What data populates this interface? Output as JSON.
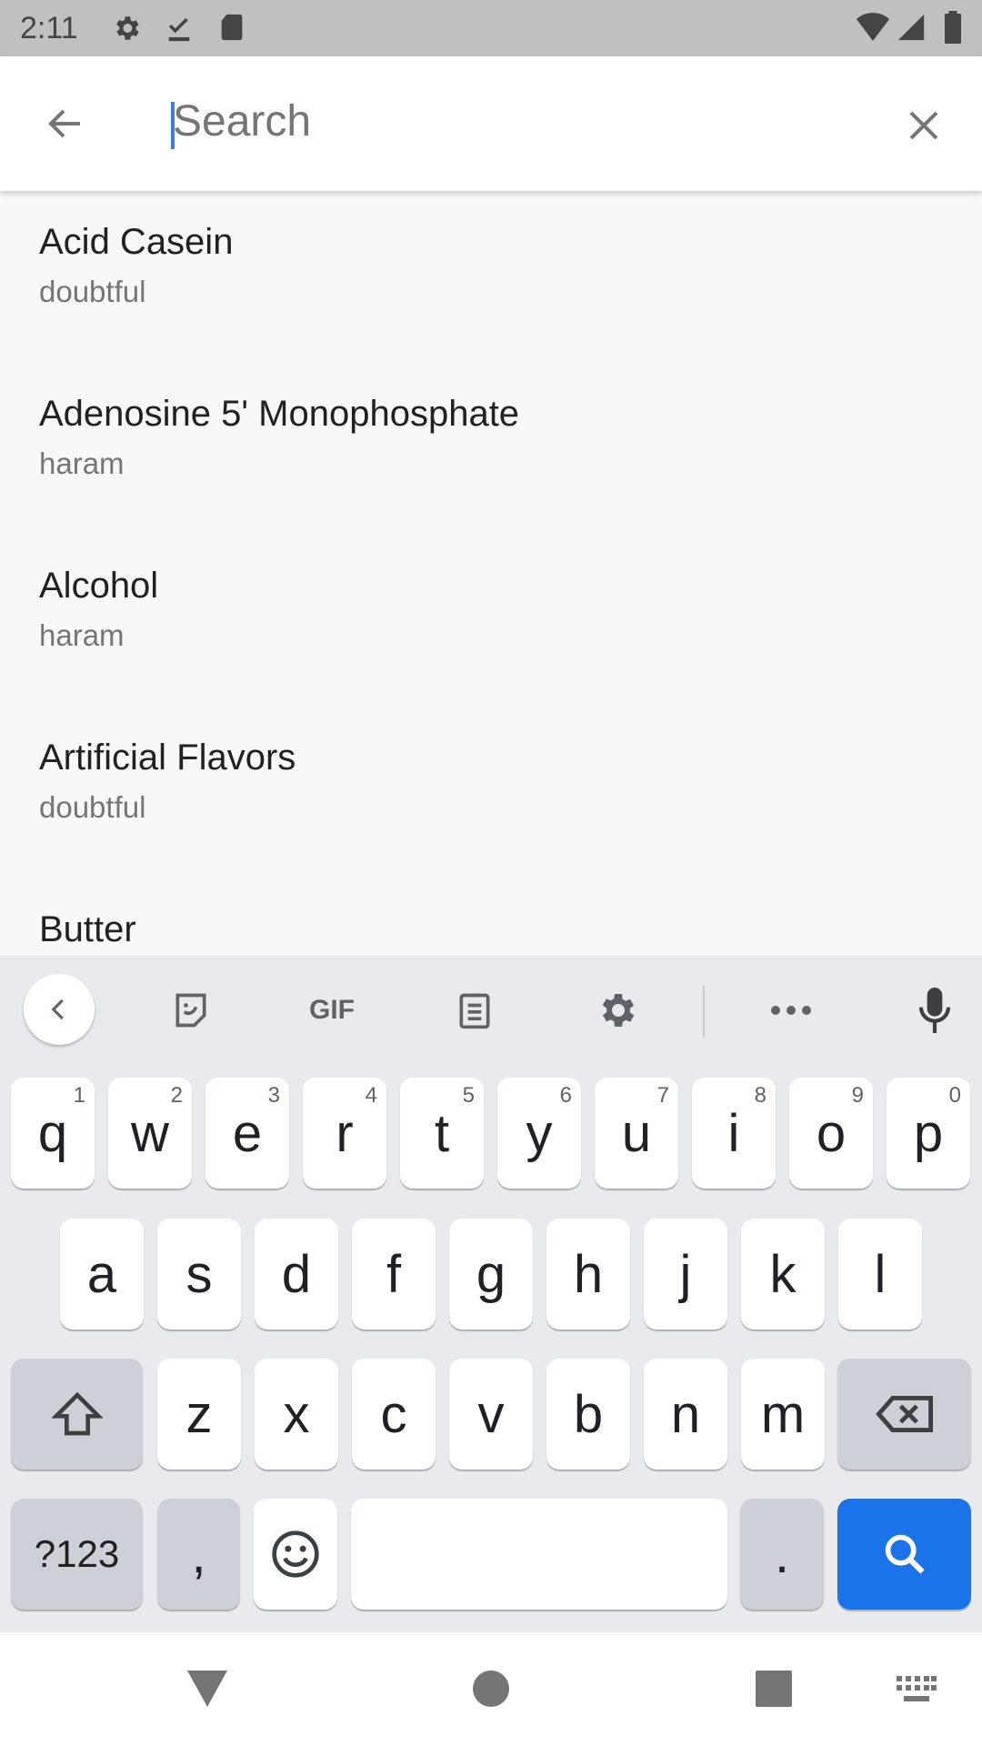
{
  "status_bar": {
    "time": "2:11",
    "icons": [
      "gear-icon",
      "download-done-icon",
      "sd-card-icon",
      "wifi-icon",
      "signal-icon",
      "battery-icon"
    ]
  },
  "app_bar": {
    "search_placeholder": "Search",
    "search_value": "",
    "back_icon": "arrow-left-icon",
    "clear_icon": "close-icon"
  },
  "list": [
    {
      "title": "Acid Casein",
      "status": "doubtful"
    },
    {
      "title": "Adenosine 5' Monophosphate",
      "status": "haram"
    },
    {
      "title": "Alcohol",
      "status": "haram"
    },
    {
      "title": "Artificial Flavors",
      "status": "doubtful"
    },
    {
      "title": "Butter",
      "status": ""
    }
  ],
  "keyboard": {
    "toolbar": {
      "gif_label": "GIF",
      "icons": [
        "chevron-left-icon",
        "sticker-icon",
        "gif-icon",
        "clipboard-icon",
        "settings-icon",
        "more-icon",
        "mic-icon"
      ]
    },
    "row1": [
      {
        "k": "q",
        "n": "1"
      },
      {
        "k": "w",
        "n": "2"
      },
      {
        "k": "e",
        "n": "3"
      },
      {
        "k": "r",
        "n": "4"
      },
      {
        "k": "t",
        "n": "5"
      },
      {
        "k": "y",
        "n": "6"
      },
      {
        "k": "u",
        "n": "7"
      },
      {
        "k": "i",
        "n": "8"
      },
      {
        "k": "o",
        "n": "9"
      },
      {
        "k": "p",
        "n": "0"
      }
    ],
    "row2": [
      "a",
      "s",
      "d",
      "f",
      "g",
      "h",
      "j",
      "k",
      "l"
    ],
    "row3": [
      "z",
      "x",
      "c",
      "v",
      "b",
      "n",
      "m"
    ],
    "symbols_label": "?123",
    "comma": ",",
    "period": ".",
    "accent_color": "#1a73e8"
  },
  "nav_bar": {
    "icons": [
      "back-triangle-icon",
      "home-circle-icon",
      "recents-square-icon",
      "keyboard-icon"
    ]
  }
}
